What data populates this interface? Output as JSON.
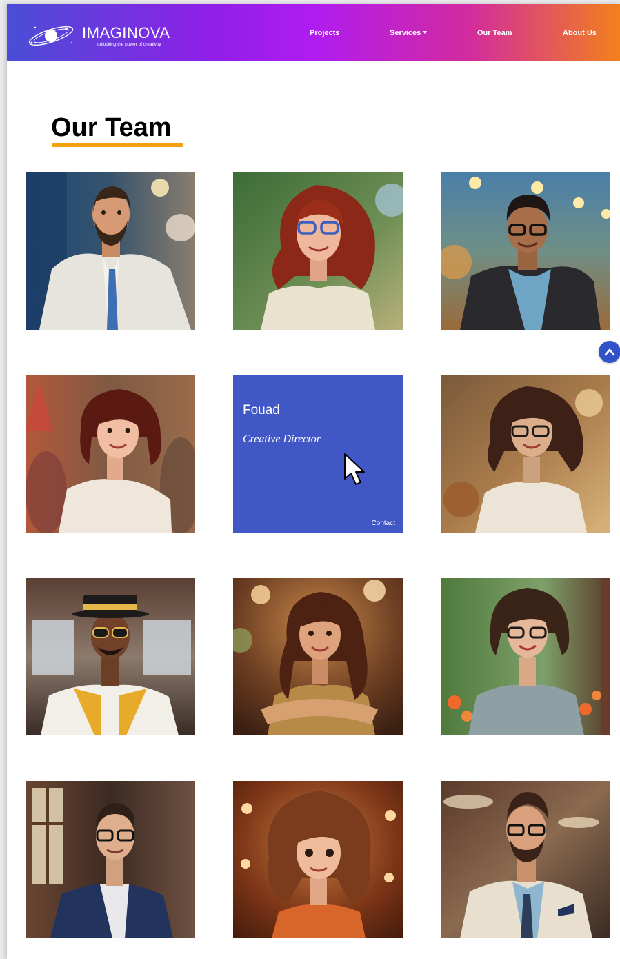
{
  "brand": {
    "name": "IMAGINOVA",
    "tagline": "unlocking the power of creativity",
    "logo_icon": "planet-ring-icon"
  },
  "nav": {
    "projects": "Projects",
    "services": "Services",
    "our_team": "Our Team",
    "about_us": "About Us"
  },
  "section": {
    "title": "Our Team"
  },
  "colors": {
    "accent_underline": "#f5a10d",
    "hover_card": "#4157c6",
    "scroll_button": "#3153c7"
  },
  "hover_member": {
    "name": "Fouad",
    "role": "Creative Director",
    "contact": "Contact"
  },
  "team_photos": [
    "bearded-man-white-blazer-blue-tie",
    "red-haired-woman-blue-glasses",
    "man-glasses-dark-jacket",
    "brunette-woman-white-blouse",
    "fouad-hover-card",
    "curly-haired-woman-glasses",
    "man-hat-sunglasses-yellow-vest",
    "woman-long-wavy-hair-arms-crossed",
    "woman-glasses-grey-shirt",
    "man-glasses-navy-blazer",
    "curly-haired-woman-orange-top",
    "bearded-man-glasses-cream-blazer"
  ],
  "scroll_top_icon": "chevron-up-icon"
}
